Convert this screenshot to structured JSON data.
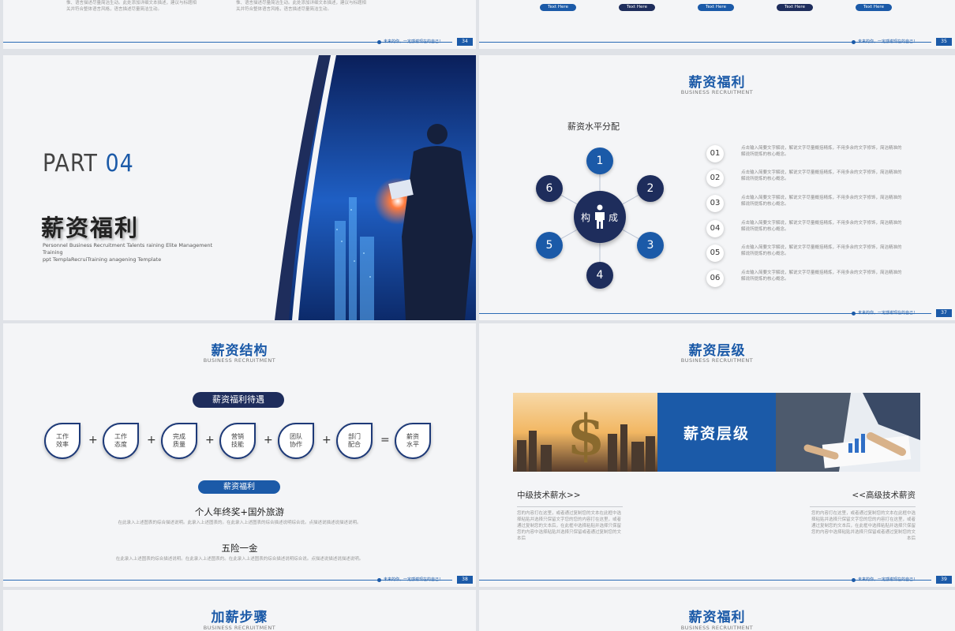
{
  "colors": {
    "accent": "#1b5aa8",
    "navy": "#1e2d5c",
    "bg": "#f4f5f7"
  },
  "footer": {
    "slogan": "未来的你，一定感谢现在的自己！"
  },
  "slide34": {
    "page": "34",
    "text_a": "惟、语言描述尽量简洁生动。此处添加详细文本描述，建议与标题相关并符合整体语言风格，语言描述尽量简洁生动。",
    "text_b": "惟、语言描述尽量简洁生动。此处添加详细文本描述，建议与标题相关并符合整体语言风格，语言描述尽量简洁生动。"
  },
  "slide35": {
    "page": "35",
    "pills": [
      "Text Here",
      "Text Here",
      "Text Here",
      "Text Here",
      "Text Here"
    ]
  },
  "slide36": {
    "part_label": "PART",
    "part_num": "04",
    "title": "薪资福利",
    "subtitle_line1": "Personnel Business Recruitment Talents raining Elite Management Training",
    "subtitle_line2": "ppt TemplaRecruiTraining anagening Template"
  },
  "slide37": {
    "page": "37",
    "title": "薪资福利",
    "subtitle": "BUSINESS RECRUITMENT",
    "diagram_title": "薪资水平分配",
    "center_left": "构",
    "center_right": "成",
    "nodes": [
      "1",
      "2",
      "3",
      "4",
      "5",
      "6"
    ],
    "list": [
      {
        "num": "01",
        "text": "点击输入简要文字解说，解说文字尽量概括精炼，不用多余的文字修饰，简洁精准的 解说所提炼的核心概念。"
      },
      {
        "num": "02",
        "text": "点击输入简要文字解说，解说文字尽量概括精炼，不用多余的文字修饰，简洁精准的 解说所提炼的核心概念。"
      },
      {
        "num": "03",
        "text": "点击输入简要文字解说，解说文字尽量概括精炼，不用多余的文字修饰，简洁精准的 解说所提炼的核心概念。"
      },
      {
        "num": "04",
        "text": "点击输入简要文字解说，解说文字尽量概括精炼，不用多余的文字修饰，简洁精准的 解说所提炼的核心概念。"
      },
      {
        "num": "05",
        "text": "点击输入简要文字解说，解说文字尽量概括精炼，不用多余的文字修饰，简洁精准的 解说所提炼的核心概念。"
      },
      {
        "num": "06",
        "text": "点击输入简要文字解说，解说文字尽量概括精炼，不用多余的文字修饰，简洁精准的 解说所提炼的核心概念。"
      }
    ]
  },
  "slide38": {
    "page": "38",
    "title": "薪资结构",
    "subtitle": "BUSINESS RECRUITMENT",
    "pill_top": "薪资福利待遇",
    "items": [
      "工作\n效率",
      "工作\n态度",
      "完成\n质量",
      "营销\n技能",
      "团队\n协作",
      "部门\n配合",
      "薪资\n水平"
    ],
    "ops": [
      "+",
      "+",
      "+",
      "+",
      "+",
      "="
    ],
    "pill_bottom": "薪资福利",
    "benefit1_title": "个人年终奖+国外旅游",
    "benefit1_text": "在此录入上述图表的综合描述说明。此录入上述图表的。在此录入上述图表的综合描述说明综合说。点描述说描述说描述说明。",
    "benefit2_title": "五险一金",
    "benefit2_text": "在此录入上述图表的综合描述说明。在此录入上述图表的。在此录入上述图表的综合描述说明综合说。点描述说描述说描述说明。"
  },
  "slide39": {
    "page": "39",
    "title": "薪资层级",
    "subtitle": "BUSINESS RECRUITMENT",
    "banner_text": "薪资层级",
    "left_heading": "中级技术薪水>>",
    "right_heading": "<<高级技术薪资",
    "left_text": "您的内容打在这里，或者通过复制您的文本在此框中选择粘贴并选择只保留文字您的您的内容打在这里，或者通过复制您的文本后，在此框中选择粘贴并选择只保留您的内容中选择粘贴并选择只保留或者通过复制您的文本后",
    "right_text": "您的内容打在这里，或者通过复制您的文本在此框中选择粘贴并选择只保留文字您的您的内容打在这里，或者通过复制您的文本后，在此框中选择粘贴并选择只保留您的内容中选择粘贴并选择只保留或者通过复制您的文本后"
  },
  "slide40": {
    "title": "加薪步骤",
    "subtitle": "BUSINESS RECRUITMENT"
  },
  "slide41": {
    "title": "薪资福利",
    "subtitle": "BUSINESS RECRUITMENT"
  }
}
